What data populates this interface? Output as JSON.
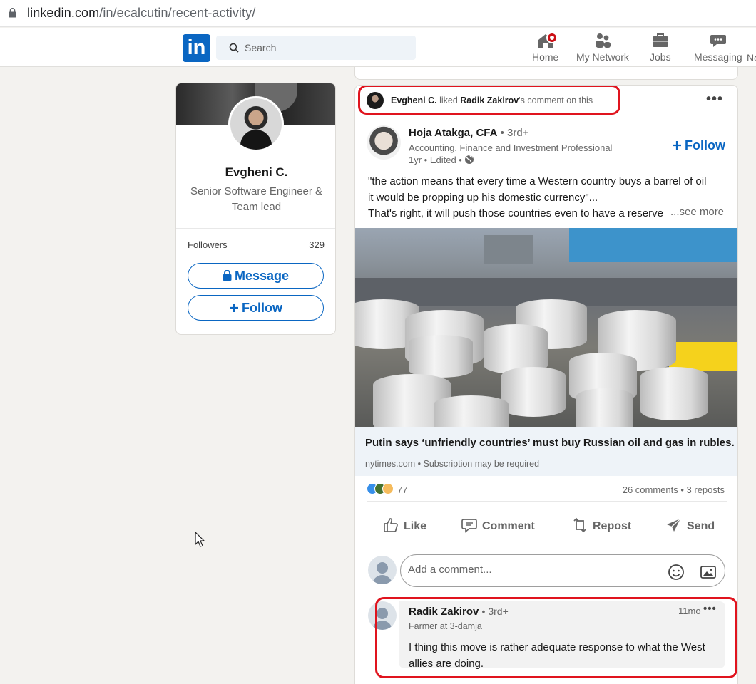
{
  "browser": {
    "url_domain": "linkedin.com",
    "url_path": "/in/ecalcutin/recent-activity/"
  },
  "nav": {
    "logo_text": "in",
    "search_placeholder": "Search",
    "items": [
      {
        "label": "Home",
        "icon": "home-icon"
      },
      {
        "label": "My Network",
        "icon": "network-icon"
      },
      {
        "label": "Jobs",
        "icon": "briefcase-icon"
      },
      {
        "label": "Messaging",
        "icon": "messaging-icon"
      },
      {
        "label": "No",
        "icon": "notifications-icon"
      }
    ]
  },
  "profile": {
    "name": "Evgheni C.",
    "headline": "Senior Software Engineer & Team lead",
    "followers_label": "Followers",
    "followers_count": "329",
    "message_label": "Message",
    "follow_label": "Follow"
  },
  "activity": {
    "actor": "Evgheni C.",
    "verb": "liked",
    "target": "Radik Zakirov",
    "suffix": "'s comment on this"
  },
  "post": {
    "author": "Hoja Atakga, CFA",
    "degree": "• 3rd+",
    "headline": "Accounting, Finance and Investment Professional",
    "meta": "1yr • Edited •",
    "follow_label": "Follow",
    "text_line1": "\"the action means that every time a Western country buys a barrel of oil",
    "text_line2": "it would be propping up his domestic currency\"...",
    "text_line3": "That's right, it will push those countries even to have a reserve",
    "see_more": "...see more",
    "link_title": "Putin says ‘unfriendly countries’ must buy Russian oil and gas in rubles.",
    "link_source": "nytimes.com • Subscription may be required",
    "reactions_count": "77",
    "stats": "26 comments • 3 reposts",
    "actions": {
      "like": "Like",
      "comment": "Comment",
      "repost": "Repost",
      "send": "Send"
    },
    "comment_placeholder": "Add a comment..."
  },
  "comment": {
    "author": "Radik Zakirov",
    "degree": "• 3rd+",
    "headline": "Farmer at 3-damja",
    "time": "11mo",
    "text": "I thing this move is rather adequate response to what the West allies are doing."
  },
  "colors": {
    "brand": "#0a66c2",
    "highlight": "#e0141e",
    "notification": "#cc1016"
  }
}
